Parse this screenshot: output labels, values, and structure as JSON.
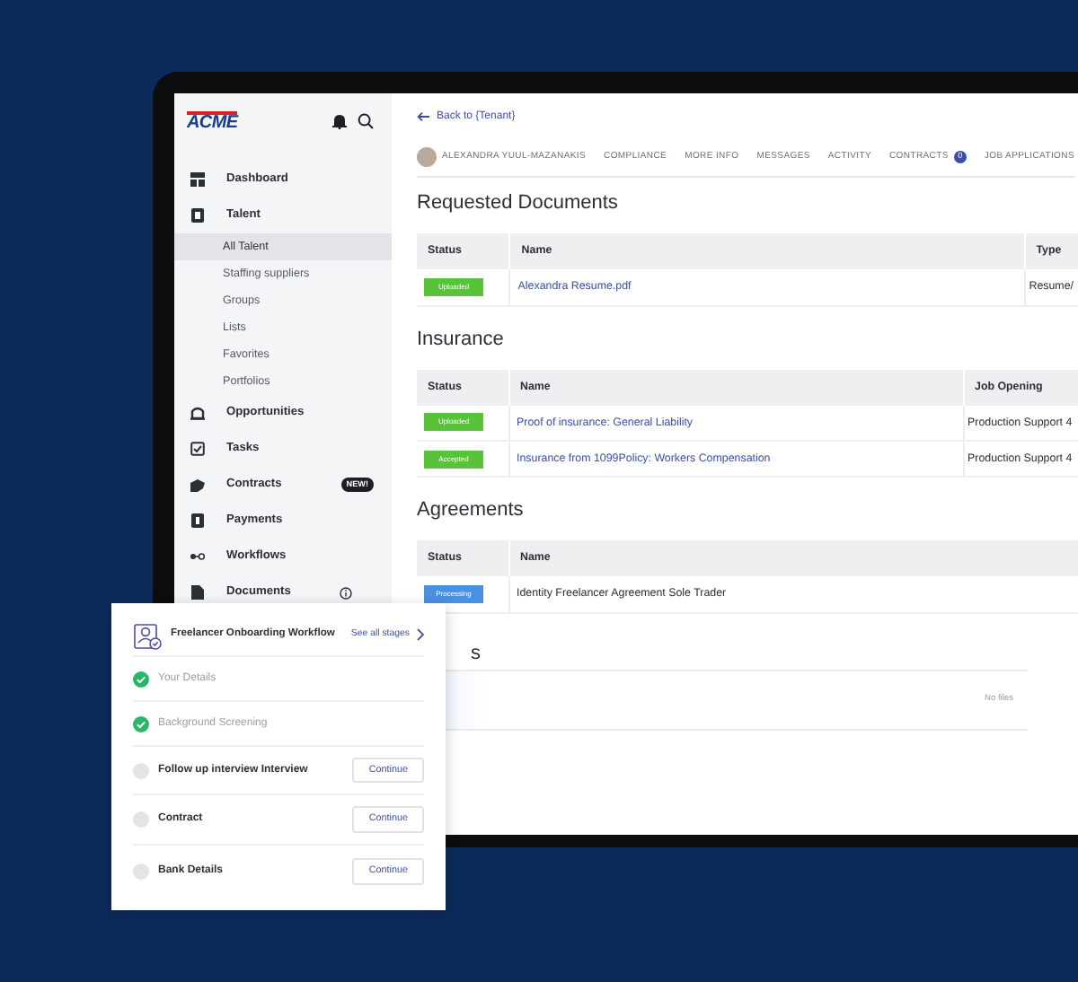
{
  "sidebar": {
    "logo": "ACME",
    "items": [
      {
        "label": "Dashboard",
        "selected": false
      },
      {
        "label": "Talent",
        "selected": false,
        "children": [
          {
            "label": "All Talent",
            "selected": true
          },
          {
            "label": "Staffing suppliers",
            "selected": false
          },
          {
            "label": "Groups",
            "selected": false
          },
          {
            "label": "Lists",
            "selected": false
          },
          {
            "label": "Favorites",
            "selected": false
          },
          {
            "label": "Portfolios",
            "selected": false
          }
        ]
      },
      {
        "label": "Opportunities",
        "selected": false
      },
      {
        "label": "Tasks",
        "selected": false
      },
      {
        "label": "Contracts",
        "selected": false,
        "badge": "NEW!"
      },
      {
        "label": "Payments",
        "selected": false
      },
      {
        "label": "Workflows",
        "selected": false
      },
      {
        "label": "Documents",
        "selected": false
      }
    ]
  },
  "back_link": "Back to {Tenant}",
  "tabs": [
    {
      "label": "ALEXANDRA YUUL-MAZANAKIS",
      "selected": false,
      "kind": "profile"
    },
    {
      "label": "COMPLIANCE",
      "selected": false,
      "kind": "plain"
    },
    {
      "label": "MORE INFO",
      "selected": false,
      "kind": "plain"
    },
    {
      "label": "MESSAGES",
      "selected": false,
      "kind": "plain"
    },
    {
      "label": "ACTIVITY",
      "selected": false,
      "kind": "plain"
    },
    {
      "label": "CONTRACTS",
      "selected": false,
      "kind": "plain",
      "count": "0"
    },
    {
      "label": "JOB APPLICATIONS",
      "selected": false,
      "kind": "plain"
    }
  ],
  "sections": [
    {
      "title": "Requested Documents",
      "columns": [
        "Status",
        "Name",
        "Type"
      ],
      "rows": [
        {
          "status": "Uploaded",
          "color": "#58c23b",
          "name": "Alexandra Resume.pdf",
          "link": true,
          "column_3": "Resume/"
        }
      ]
    },
    {
      "title": "Insurance",
      "columns": [
        "Status",
        "Name",
        "Job Opening"
      ],
      "rows": [
        {
          "status": "Uploaded",
          "color": "#58c23b",
          "name": "Proof of insurance: General Liability",
          "link": true,
          "column_3": "Production Support 4"
        },
        {
          "status": "Accepted",
          "color": "#58c23b",
          "name": "Insurance from 1099Policy: Workers Compensation",
          "link": true,
          "column_3": "Production Support 4"
        }
      ]
    },
    {
      "title": "Agreements",
      "columns": [
        "Status",
        "Name"
      ],
      "rows": [
        {
          "status": "Processing",
          "color": "#4a90e2",
          "name": "Identity Freelancer Agreement Sole Trader",
          "link": false
        }
      ]
    }
  ],
  "partial_section": {
    "title": "s",
    "empty_text": "No files"
  },
  "workflow_card": {
    "title": "Freelancer Onboarding Workflow",
    "see_all": "See all stages",
    "steps": [
      {
        "label": "Your Details",
        "done": true
      },
      {
        "label": "Background Screening",
        "done": true
      },
      {
        "label": "Follow up interview Interview",
        "done": false,
        "button": "Continue"
      },
      {
        "label": "Contract",
        "done": false,
        "button": "Continue"
      },
      {
        "label": "Bank Details",
        "done": false,
        "button": "Continue"
      }
    ]
  }
}
